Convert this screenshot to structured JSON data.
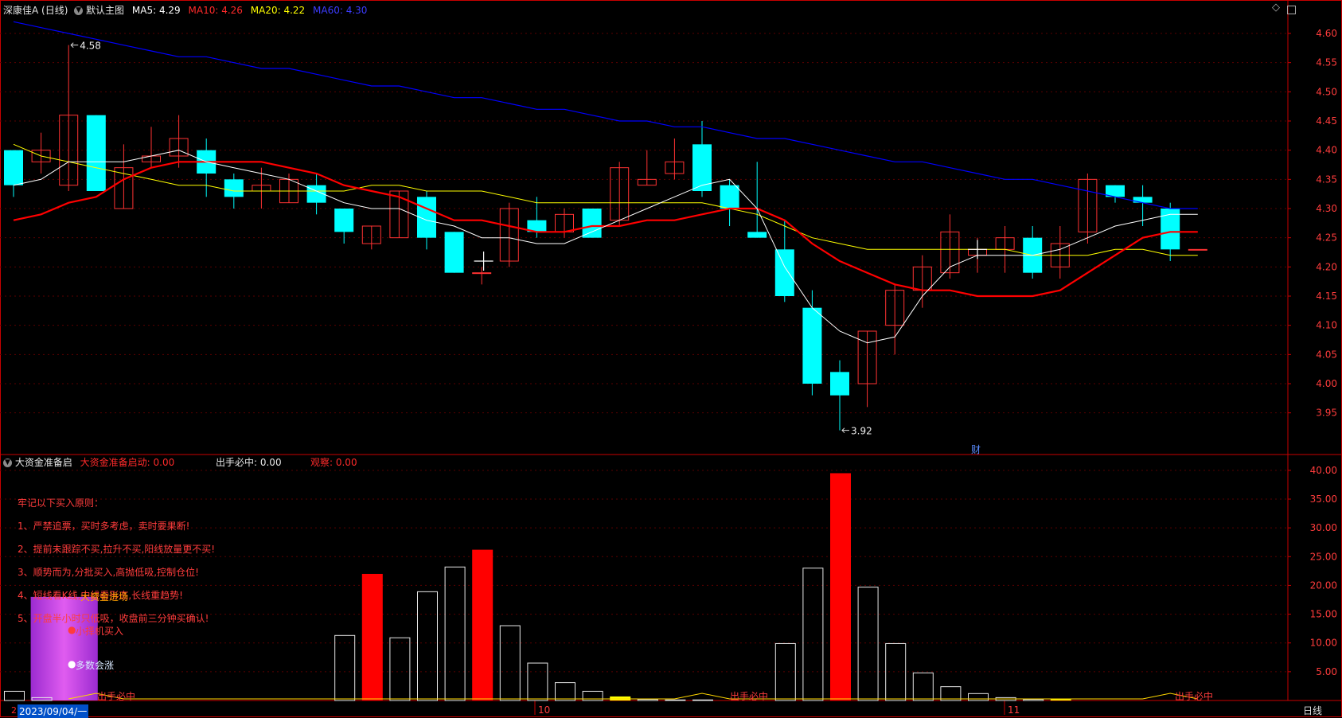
{
  "header": {
    "stock_name": "深康佳A (日线)",
    "template": "默认主图",
    "ma5_label": "MA5:",
    "ma5_value": "4.29",
    "ma10_label": "MA10:",
    "ma10_value": "4.26",
    "ma20_label": "MA20:",
    "ma20_value": "4.22",
    "ma60_label": "MA60:",
    "ma60_value": "4.30"
  },
  "indicator_header": {
    "name": "大资金准备启",
    "start_label": "大资金准备启动: 0.00",
    "strike_label": "出手必中: 0.00",
    "watch_label": "观察: 0.00"
  },
  "rules": [
    "牢记以下买入原则：",
    "1、严禁追票，买时多考虑，卖时要果断!",
    "2、提前未跟踪不买,拉升不买,阳线放量更不买!",
    "3、顺势而为,分批买入,高抛低吸,控制仓位!",
    "4、短线看K线,中线看形态,长线重趋势!",
    "5、开盘半小时只低吸，收盘前三分钟买确认!"
  ],
  "legend_labels": {
    "funds": "大资金进场",
    "buy": "小择机买入",
    "rise": "多数会涨",
    "strike": "出手必中"
  },
  "footer": {
    "date": "2023/09/04/一",
    "period": "日线",
    "left_marker": "2",
    "caibao": "财"
  },
  "colors": {
    "up": "#ff3232",
    "down": "#00ffff",
    "ma5": "#ffffff",
    "ma10": "#ff0000",
    "ma20": "#ffff00",
    "ma60": "#0000ff",
    "grid": "#5a0000",
    "axis": "#c80000"
  },
  "chart_data": [
    {
      "type": "candlestick",
      "x_tick_labels": [
        "10",
        "11"
      ],
      "ylim": [
        3.88,
        4.63
      ],
      "y_ticks": [
        "4.60",
        "4.55",
        "4.50",
        "4.45",
        "4.40",
        "4.35",
        "4.30",
        "4.25",
        "4.20",
        "4.15",
        "4.10",
        "4.05",
        "4.00",
        "3.95"
      ],
      "annotations": [
        {
          "text": "4.58",
          "bar": 2
        },
        {
          "text": "3.92",
          "bar": 30
        }
      ],
      "candles": [
        [
          4.4,
          4.34,
          4.4,
          4.32
        ],
        [
          4.38,
          4.4,
          4.43,
          4.36
        ],
        [
          4.34,
          4.46,
          4.58,
          4.33
        ],
        [
          4.46,
          4.33,
          4.46,
          4.33
        ],
        [
          4.3,
          4.37,
          4.41,
          4.3
        ],
        [
          4.38,
          4.39,
          4.44,
          4.37
        ],
        [
          4.39,
          4.42,
          4.46,
          4.37
        ],
        [
          4.4,
          4.36,
          4.42,
          4.32
        ],
        [
          4.35,
          4.32,
          4.36,
          4.3
        ],
        [
          4.33,
          4.34,
          4.37,
          4.3
        ],
        [
          4.31,
          4.35,
          4.36,
          4.31
        ],
        [
          4.34,
          4.31,
          4.36,
          4.29
        ],
        [
          4.3,
          4.26,
          4.3,
          4.24
        ],
        [
          4.24,
          4.27,
          4.27,
          4.23
        ],
        [
          4.25,
          4.33,
          4.33,
          4.25
        ],
        [
          4.32,
          4.25,
          4.33,
          4.23
        ],
        [
          4.26,
          4.19,
          4.26,
          4.19
        ],
        [
          4.19,
          4.19,
          4.2,
          4.17
        ],
        [
          4.21,
          4.3,
          4.31,
          4.2
        ],
        [
          4.28,
          4.26,
          4.32,
          4.25
        ],
        [
          4.26,
          4.29,
          4.3,
          4.25
        ],
        [
          4.3,
          4.25,
          4.3,
          4.25
        ],
        [
          4.28,
          4.37,
          4.38,
          4.27
        ],
        [
          4.34,
          4.35,
          4.4,
          4.34
        ],
        [
          4.36,
          4.38,
          4.42,
          4.35
        ],
        [
          4.41,
          4.33,
          4.45,
          4.32
        ],
        [
          4.34,
          4.3,
          4.35,
          4.27
        ],
        [
          4.26,
          4.25,
          4.38,
          4.25
        ],
        [
          4.23,
          4.15,
          4.28,
          4.14
        ],
        [
          4.13,
          4.0,
          4.16,
          3.98
        ],
        [
          4.02,
          3.98,
          4.04,
          3.92
        ],
        [
          4.0,
          4.09,
          4.09,
          3.96
        ],
        [
          4.1,
          4.16,
          4.17,
          4.05
        ],
        [
          4.16,
          4.2,
          4.22,
          4.13
        ],
        [
          4.19,
          4.26,
          4.29,
          4.18
        ],
        [
          4.22,
          4.23,
          4.25,
          4.19
        ],
        [
          4.23,
          4.25,
          4.27,
          4.19
        ],
        [
          4.25,
          4.19,
          4.27,
          4.18
        ],
        [
          4.2,
          4.24,
          4.27,
          4.18
        ],
        [
          4.26,
          4.35,
          4.36,
          4.24
        ],
        [
          4.34,
          4.32,
          4.34,
          4.31
        ],
        [
          4.32,
          4.31,
          4.34,
          4.27
        ],
        [
          4.3,
          4.23,
          4.31,
          4.21
        ],
        [
          4.23,
          4.23,
          4.23,
          4.23
        ]
      ],
      "ma5": [
        4.34,
        4.35,
        4.38,
        4.38,
        4.38,
        4.39,
        4.4,
        4.38,
        4.37,
        4.36,
        4.35,
        4.33,
        4.31,
        4.3,
        4.3,
        4.28,
        4.27,
        4.25,
        4.25,
        4.24,
        4.24,
        4.26,
        4.28,
        4.3,
        4.32,
        4.34,
        4.35,
        4.3,
        4.2,
        4.13,
        4.09,
        4.07,
        4.08,
        4.15,
        4.2,
        4.22,
        4.22,
        4.22,
        4.23,
        4.25,
        4.27,
        4.28,
        4.29,
        4.29
      ],
      "ma10": [
        4.28,
        4.29,
        4.31,
        4.32,
        4.35,
        4.37,
        4.38,
        4.38,
        4.38,
        4.38,
        4.37,
        4.36,
        4.34,
        4.33,
        4.32,
        4.3,
        4.28,
        4.28,
        4.27,
        4.26,
        4.26,
        4.27,
        4.27,
        4.28,
        4.28,
        4.29,
        4.3,
        4.3,
        4.28,
        4.24,
        4.21,
        4.19,
        4.17,
        4.16,
        4.16,
        4.15,
        4.15,
        4.15,
        4.16,
        4.19,
        4.22,
        4.25,
        4.26,
        4.26
      ],
      "ma20": [
        4.41,
        4.39,
        4.38,
        4.37,
        4.36,
        4.35,
        4.34,
        4.34,
        4.33,
        4.33,
        4.33,
        4.33,
        4.33,
        4.34,
        4.34,
        4.33,
        4.33,
        4.33,
        4.32,
        4.31,
        4.31,
        4.31,
        4.31,
        4.31,
        4.31,
        4.31,
        4.3,
        4.29,
        4.27,
        4.25,
        4.24,
        4.23,
        4.23,
        4.23,
        4.23,
        4.23,
        4.23,
        4.22,
        4.22,
        4.22,
        4.23,
        4.23,
        4.22,
        4.22
      ],
      "ma60": [
        4.62,
        4.61,
        4.6,
        4.59,
        4.58,
        4.57,
        4.56,
        4.56,
        4.55,
        4.54,
        4.54,
        4.53,
        4.52,
        4.51,
        4.51,
        4.5,
        4.49,
        4.49,
        4.48,
        4.47,
        4.47,
        4.46,
        4.45,
        4.45,
        4.44,
        4.44,
        4.43,
        4.42,
        4.42,
        4.41,
        4.4,
        4.39,
        4.38,
        4.38,
        4.37,
        4.36,
        4.35,
        4.35,
        4.34,
        4.33,
        4.32,
        4.31,
        4.3,
        4.3
      ]
    },
    {
      "type": "bar",
      "ylim": [
        0,
        41.5
      ],
      "y_ticks": [
        "40.00",
        "35.00",
        "30.00",
        "25.00",
        "20.00",
        "15.00",
        "10.00",
        "5.00"
      ],
      "values": [
        1.6,
        0.5,
        0,
        0,
        0,
        0,
        0,
        0,
        0,
        0,
        0,
        0,
        11.3,
        22.0,
        10.9,
        18.9,
        23.2,
        26.2,
        13.0,
        6.5,
        3.1,
        1.6,
        0.7,
        0.2,
        0.1,
        0.1,
        0,
        0,
        9.9,
        23.0,
        39.5,
        19.7,
        9.9,
        4.8,
        2.4,
        1.2,
        0.5,
        0.2,
        0.2,
        0,
        0,
        0,
        0,
        0
      ],
      "styles": [
        "w",
        "w",
        "",
        "",
        "",
        "",
        "",
        "",
        "",
        "",
        "",
        "",
        "w",
        "r",
        "w",
        "w",
        "w",
        "r",
        "w",
        "w",
        "w",
        "w",
        "y",
        "w",
        "w",
        "w",
        "",
        "",
        "w",
        "w",
        "r",
        "w",
        "w",
        "w",
        "w",
        "w",
        "w",
        "w",
        "y",
        "",
        "",
        "",
        "",
        ""
      ],
      "funds_block": {
        "value": 18,
        "bars": [
          1,
          3
        ]
      }
    }
  ]
}
